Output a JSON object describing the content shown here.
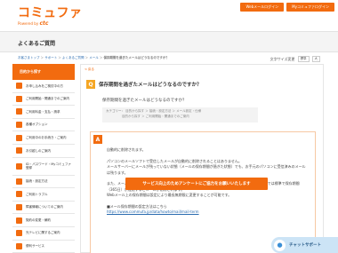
{
  "header": {
    "logo_text": "コミュファ",
    "logo_powered": "Powered by",
    "logo_ctc": "ctc",
    "buttons": [
      "Webメールログイン",
      "Myコミュファログイン"
    ]
  },
  "page_title": "よくあるご質問",
  "breadcrumb": [
    "お客さまトップ",
    "サポート",
    "よくあるご質問",
    "メール",
    "保存期間を過ぎたメールはどうなるのですか？"
  ],
  "font_size": {
    "label": "文字サイズ変更",
    "options": [
      "標準",
      "大"
    ]
  },
  "sidebar": {
    "heading": "目的から探す",
    "items": [
      "お申し込みをご検討中の方",
      "ご利用開始・開通までのご案内",
      "ご利用料金・支払・請求",
      "各種オプション",
      "ご利用中のお手続き・ご案内",
      "お引越しのご案内",
      "ID・パスワード・Myコミュファ登録",
      "接続・設定方法",
      "ご利用トラブル",
      "障害情報についてのご案内",
      "契約の変更・解約",
      "光テレビに関するご案内",
      "便利サービス"
    ]
  },
  "main": {
    "back_label": "戻る",
    "question_badge": "Q",
    "question_title": "保存期間を過ぎたメールはどうなるのですか？",
    "question_text": "保存期間を過ぎたメールはどうなるのですか？",
    "category_label": "カテゴリー：",
    "category_lines": [
      "目的から探す ＞ 接続・設定方法 ＞ メール設定・仕様",
      "目的から探す ＞ ご利用開始・開通までのご案内"
    ],
    "answer_badge": "A",
    "answer_paragraphs": [
      "自動的に削除されます。",
      "パソコンのメールソフトで受信したメールが自動的に削除されることはありません。\nメールサーバーにメールが残っていない状態（メールの保存期間が過ぎた状態）でも、お手元のパソコンに受信済みのメールは残ります。",
      "また、メールソフトで「メールをサーバーに残す」の設定を行った場合、Webメール側（サーバー）では標準で保存期間（365日）が経過するとメールが削除されます。\nWebメール上の保存期間は設定により最長無期限に変更することが可能です。"
    ],
    "answer_link_label": "■メール保存期間の設定方法はこちら",
    "answer_link": "https://www.commufa.jp/data/howto/mail/mail-term",
    "survey_button": "サービス向上のためアンケートにご協力をお願いいたします"
  },
  "chat": {
    "label": "チャットサポート"
  },
  "colors": {
    "brand": "#f26b0f",
    "accent": "#f5a623",
    "link": "#2b6cb0"
  }
}
